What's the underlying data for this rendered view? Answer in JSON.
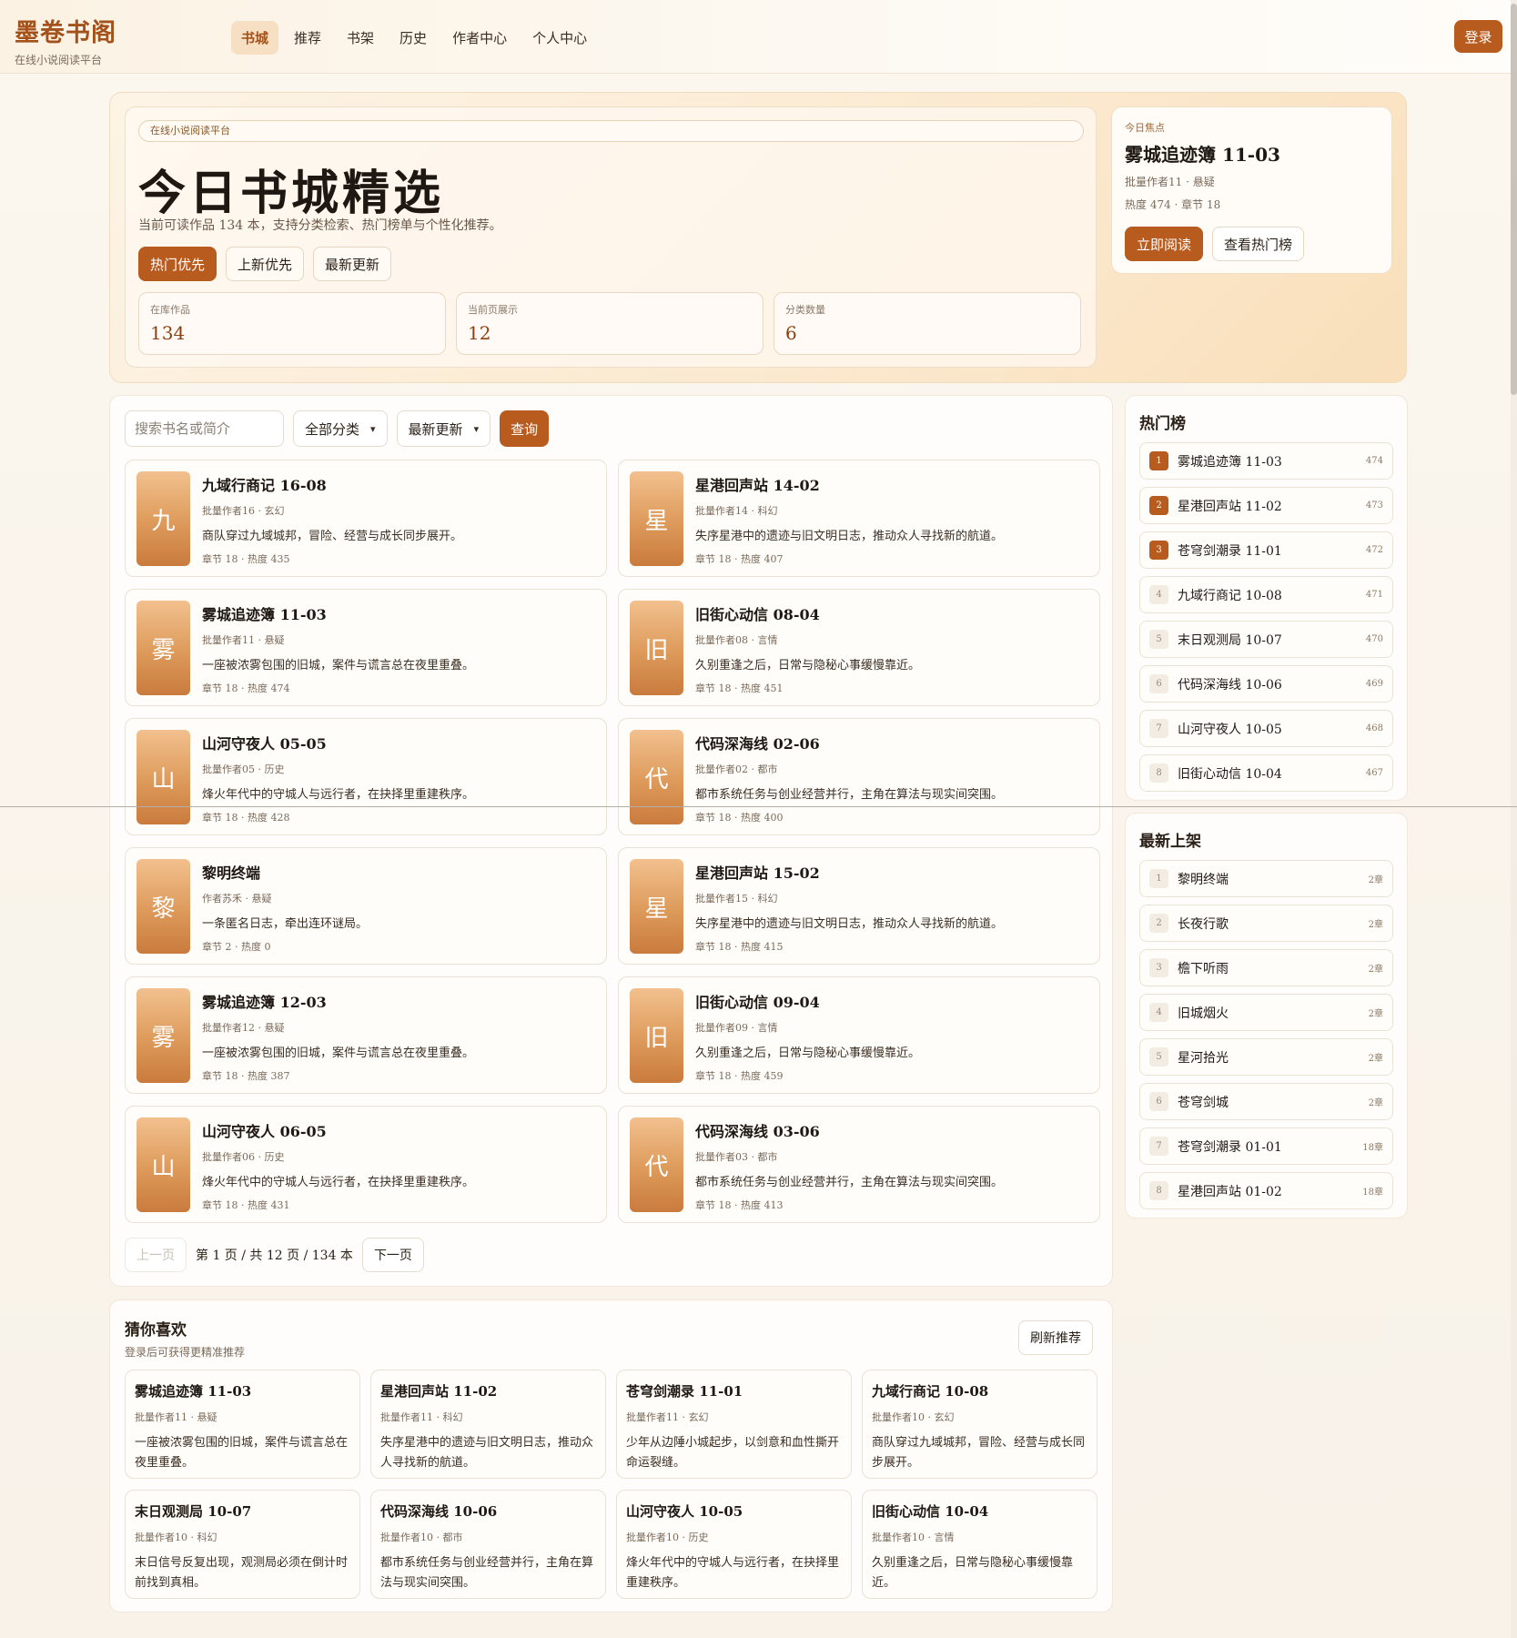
{
  "header": {
    "brand": "墨卷书阁",
    "brand_sub": "在线小说阅读平台",
    "nav": [
      "书城",
      "推荐",
      "书架",
      "历史",
      "作者中心",
      "个人中心"
    ],
    "login": "登录"
  },
  "hero": {
    "tag": "在线小说阅读平台",
    "title": "今日书城精选",
    "desc": "当前可读作品 134 本，支持分类检索、热门榜单与个性化推荐。",
    "sorts": [
      "热门优先",
      "上新优先",
      "最新更新"
    ],
    "stats": [
      {
        "label": "在库作品",
        "value": "134"
      },
      {
        "label": "当前页展示",
        "value": "12"
      },
      {
        "label": "分类数量",
        "value": "6"
      }
    ],
    "focus": {
      "label": "今日焦点",
      "title": "雾城追迹簿 11-03",
      "meta1": "批量作者11 · 悬疑",
      "meta2": "热度 474 · 章节 18",
      "read_btn": "立即阅读",
      "hot_btn": "查看热门榜"
    }
  },
  "search": {
    "placeholder": "搜索书名或简介",
    "category": "全部分类",
    "order": "最新更新",
    "query": "查询"
  },
  "books": [
    {
      "cover": "九",
      "title": "九域行商记 16-08",
      "meta": "批量作者16 · 玄幻",
      "desc": "商队穿过九域城邦，冒险、经营与成长同步展开。",
      "stats": "章节 18 · 热度 435"
    },
    {
      "cover": "星",
      "title": "星港回声站 14-02",
      "meta": "批量作者14 · 科幻",
      "desc": "失序星港中的遗迹与旧文明日志，推动众人寻找新的航道。",
      "stats": "章节 18 · 热度 407"
    },
    {
      "cover": "雾",
      "title": "雾城追迹簿 11-03",
      "meta": "批量作者11 · 悬疑",
      "desc": "一座被浓雾包围的旧城，案件与谎言总在夜里重叠。",
      "stats": "章节 18 · 热度 474"
    },
    {
      "cover": "旧",
      "title": "旧街心动信 08-04",
      "meta": "批量作者08 · 言情",
      "desc": "久别重逢之后，日常与隐秘心事缓慢靠近。",
      "stats": "章节 18 · 热度 451"
    },
    {
      "cover": "山",
      "title": "山河守夜人 05-05",
      "meta": "批量作者05 · 历史",
      "desc": "烽火年代中的守城人与远行者，在抉择里重建秩序。",
      "stats": "章节 18 · 热度 428"
    },
    {
      "cover": "代",
      "title": "代码深海线 02-06",
      "meta": "批量作者02 · 都市",
      "desc": "都市系统任务与创业经营并行，主角在算法与现实间突围。",
      "stats": "章节 18 · 热度 400"
    },
    {
      "cover": "黎",
      "title": "黎明终端",
      "meta": "作者苏禾 · 悬疑",
      "desc": "一条匿名日志，牵出连环谜局。",
      "stats": "章节 2 · 热度 0"
    },
    {
      "cover": "星",
      "title": "星港回声站 15-02",
      "meta": "批量作者15 · 科幻",
      "desc": "失序星港中的遗迹与旧文明日志，推动众人寻找新的航道。",
      "stats": "章节 18 · 热度 415"
    },
    {
      "cover": "雾",
      "title": "雾城追迹簿 12-03",
      "meta": "批量作者12 · 悬疑",
      "desc": "一座被浓雾包围的旧城，案件与谎言总在夜里重叠。",
      "stats": "章节 18 · 热度 387"
    },
    {
      "cover": "旧",
      "title": "旧街心动信 09-04",
      "meta": "批量作者09 · 言情",
      "desc": "久别重逢之后，日常与隐秘心事缓慢靠近。",
      "stats": "章节 18 · 热度 459"
    },
    {
      "cover": "山",
      "title": "山河守夜人 06-05",
      "meta": "批量作者06 · 历史",
      "desc": "烽火年代中的守城人与远行者，在抉择里重建秩序。",
      "stats": "章节 18 · 热度 431"
    },
    {
      "cover": "代",
      "title": "代码深海线 03-06",
      "meta": "批量作者03 · 都市",
      "desc": "都市系统任务与创业经营并行，主角在算法与现实间突围。",
      "stats": "章节 18 · 热度 413"
    }
  ],
  "pager": {
    "prev": "上一页",
    "info": "第 1 页 / 共 12 页 / 134 本",
    "next": "下一页"
  },
  "hot": {
    "title": "热门榜",
    "items": [
      {
        "rank": "1",
        "name": "雾城追迹簿 11-03",
        "value": "474"
      },
      {
        "rank": "2",
        "name": "星港回声站 11-02",
        "value": "473"
      },
      {
        "rank": "3",
        "name": "苍穹剑潮录 11-01",
        "value": "472"
      },
      {
        "rank": "4",
        "name": "九域行商记 10-08",
        "value": "471"
      },
      {
        "rank": "5",
        "name": "末日观测局 10-07",
        "value": "470"
      },
      {
        "rank": "6",
        "name": "代码深海线 10-06",
        "value": "469"
      },
      {
        "rank": "7",
        "name": "山河守夜人 10-05",
        "value": "468"
      },
      {
        "rank": "8",
        "name": "旧街心动信 10-04",
        "value": "467"
      }
    ]
  },
  "latest": {
    "title": "最新上架",
    "items": [
      {
        "rank": "1",
        "name": "黎明终端",
        "value": "2章"
      },
      {
        "rank": "2",
        "name": "长夜行歌",
        "value": "2章"
      },
      {
        "rank": "3",
        "name": "檐下听雨",
        "value": "2章"
      },
      {
        "rank": "4",
        "name": "旧城烟火",
        "value": "2章"
      },
      {
        "rank": "5",
        "name": "星河拾光",
        "value": "2章"
      },
      {
        "rank": "6",
        "name": "苍穹剑城",
        "value": "2章"
      },
      {
        "rank": "7",
        "name": "苍穹剑潮录 01-01",
        "value": "18章"
      },
      {
        "rank": "8",
        "name": "星港回声站 01-02",
        "value": "18章"
      }
    ]
  },
  "recommend": {
    "title": "猜你喜欢",
    "sub": "登录后可获得更精准推荐",
    "refresh": "刷新推荐",
    "items": [
      {
        "title": "雾城追迹簿 11-03",
        "meta": "批量作者11 · 悬疑",
        "desc": "一座被浓雾包围的旧城，案件与谎言总在夜里重叠。"
      },
      {
        "title": "星港回声站 11-02",
        "meta": "批量作者11 · 科幻",
        "desc": "失序星港中的遗迹与旧文明日志，推动众人寻找新的航道。"
      },
      {
        "title": "苍穹剑潮录 11-01",
        "meta": "批量作者11 · 玄幻",
        "desc": "少年从边陲小城起步，以剑意和血性撕开命运裂缝。"
      },
      {
        "title": "九域行商记 10-08",
        "meta": "批量作者10 · 玄幻",
        "desc": "商队穿过九域城邦，冒险、经营与成长同步展开。"
      },
      {
        "title": "末日观测局 10-07",
        "meta": "批量作者10 · 科幻",
        "desc": "末日信号反复出现，观测局必须在倒计时前找到真相。"
      },
      {
        "title": "代码深海线 10-06",
        "meta": "批量作者10 · 都市",
        "desc": "都市系统任务与创业经营并行，主角在算法与现实间突围。"
      },
      {
        "title": "山河守夜人 10-05",
        "meta": "批量作者10 · 历史",
        "desc": "烽火年代中的守城人与远行者，在抉择里重建秩序。"
      },
      {
        "title": "旧街心动信 10-04",
        "meta": "批量作者10 · 言情",
        "desc": "久别重逢之后，日常与隐秘心事缓慢靠近。"
      }
    ]
  }
}
